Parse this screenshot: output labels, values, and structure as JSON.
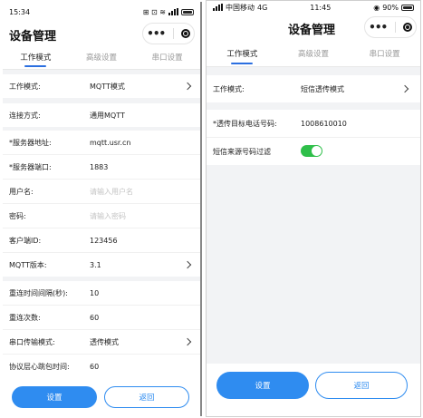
{
  "left": {
    "status": {
      "time": "15:34",
      "right": "⊞ ⊡ ≋",
      "battery_text": ""
    },
    "title": "设备管理",
    "tabs": [
      "工作模式",
      "高级设置",
      "串口设置"
    ],
    "rows": [
      {
        "label": "工作模式:",
        "value": "MQTT模式",
        "chevron": true
      },
      {
        "label": "连接方式:",
        "value": "通用MQTT",
        "chevron": false
      },
      {
        "label": "*服务器地址:",
        "value": "mqtt.usr.cn",
        "chevron": false
      },
      {
        "label": "*服务器端口:",
        "value": "1883",
        "chevron": false
      },
      {
        "label": "用户名:",
        "placeholder": "请输入用户名",
        "chevron": false
      },
      {
        "label": "密码:",
        "placeholder": "请输入密码",
        "chevron": false
      },
      {
        "label": "客户端ID:",
        "value": "123456",
        "chevron": false
      },
      {
        "label": "MQTT版本:",
        "value": "3.1",
        "chevron": true
      },
      {
        "label": "重连时间间隔(秒):",
        "value": "10",
        "chevron": false
      },
      {
        "label": "重连次数:",
        "value": "60",
        "chevron": false
      },
      {
        "label": "串口传输模式:",
        "value": "透传模式",
        "chevron": true
      },
      {
        "label": "协议层心跳包时间:",
        "value": "60",
        "chevron": false
      }
    ],
    "buttons": {
      "primary": "设置",
      "secondary": "返回"
    }
  },
  "right": {
    "status": {
      "carrier": "中国移动",
      "network": "4G",
      "time": "11:45",
      "battery": "90%"
    },
    "title": "设备管理",
    "tabs": [
      "工作模式",
      "高级设置",
      "串口设置"
    ],
    "rows": [
      {
        "label": "工作模式:",
        "value": "短信透传模式",
        "chevron": true
      },
      {
        "label": "*透传目标电话号码:",
        "value": "1008610010",
        "chevron": false
      },
      {
        "label": "短信来源号码过滤",
        "toggle": true
      }
    ],
    "buttons": {
      "primary": "设置",
      "secondary": "返回"
    }
  },
  "colors": {
    "accent": "#2f8cf0",
    "tab_indicator": "#2b6fe0",
    "toggle_on": "#2fbf4a",
    "background": "#f2f3f5"
  }
}
